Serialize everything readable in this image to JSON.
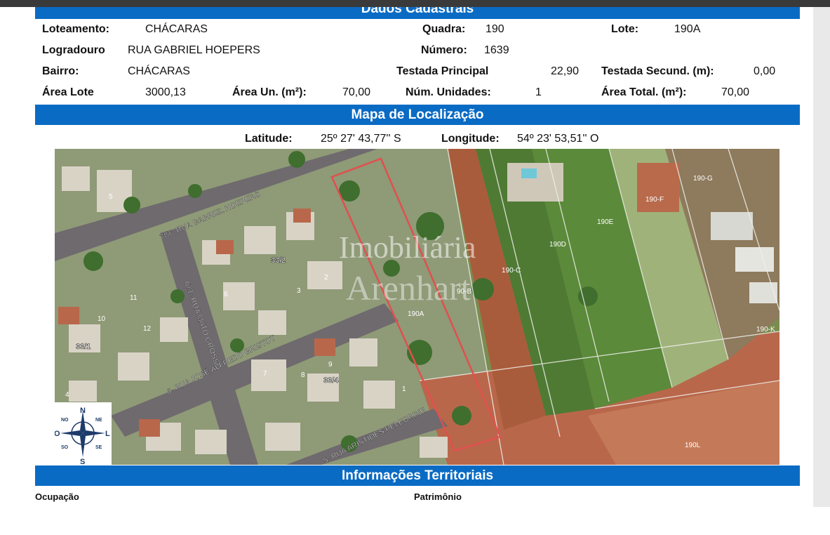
{
  "sections": {
    "cadastral": "Dados Cadastrais",
    "map": "Mapa de Localização",
    "territorial": "Informações Territoriais"
  },
  "cadastral": {
    "loteamento_label": "Loteamento:",
    "loteamento": "CHÁCARAS",
    "quadra_label": "Quadra:",
    "quadra": "190",
    "lote_label": "Lote:",
    "lote": "190A",
    "logradouro_label": "Logradouro",
    "logradouro": "RUA GABRIEL HOEPERS",
    "numero_label": "Número:",
    "numero": "1639",
    "bairro_label": "Bairro:",
    "bairro": "CHÁCARAS",
    "testada_principal_label": "Testada Principal",
    "testada_principal": "22,90",
    "testada_secund_label": "Testada Secund. (m):",
    "testada_secund": "0,00",
    "area_lote_label": "Área Lote",
    "area_lote": "3000,13",
    "area_un_label": "Área Un. (m²):",
    "area_un": "70,00",
    "num_unidades_label": "Núm. Unidades:",
    "num_unidades": "1",
    "area_total_label": "Área Total. (m²):",
    "area_total": "70,00"
  },
  "location": {
    "lat_label": "Latitude:",
    "lat": "25º 27' 43,77'' S",
    "lon_label": "Longitude:",
    "lon": "54º 23' 53,51'' O"
  },
  "map_labels": {
    "street1": "787- RUA GABRIEL HOEPERS",
    "street2": "671- RUA MATO GROSSO",
    "street3": "6- RUA JOSÉ ALFREDO BRISTOT",
    "street4": "5- RUA ARISTIDES PELEGRINE",
    "watermark1": "Imobiliária",
    "watermark2": "Arenhart",
    "lots": [
      "190A",
      "90-B",
      "190-C",
      "190D",
      "190E",
      "190-F",
      "190-G",
      "190-K",
      "190L",
      "33/2",
      "33/1",
      "33/4",
      "5",
      "6",
      "7",
      "8",
      "9",
      "10",
      "11",
      "12",
      "1",
      "2",
      "3",
      "4"
    ]
  },
  "compass": {
    "n": "N",
    "s": "S",
    "l": "L",
    "o": "O",
    "ne": "NE",
    "no": "NO",
    "se": "SE",
    "so": "SO"
  },
  "territorial": {
    "ocupacao_label": "Ocupação",
    "patrimonio_label": "Patrimônio"
  }
}
